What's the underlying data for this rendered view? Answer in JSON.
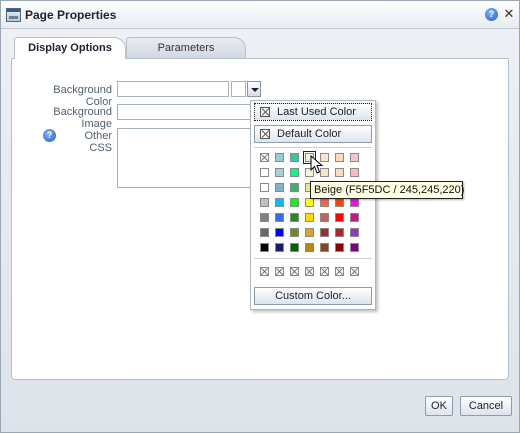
{
  "window": {
    "title": "Page Properties",
    "help_label": "?",
    "close_label": "✕"
  },
  "tabs": [
    {
      "label": "Display Options",
      "active": true
    },
    {
      "label": "Parameters",
      "active": false
    }
  ],
  "form": {
    "background_color": {
      "label": "Background Color",
      "value": ""
    },
    "background_image": {
      "label": "Background Image",
      "value": ""
    },
    "other_css": {
      "label": "Other CSS",
      "value": "",
      "help_label": "?"
    }
  },
  "color_picker": {
    "last_used_label": "Last Used Color",
    "default_label": "Default Color",
    "custom_label": "Custom Color...",
    "hovered_tooltip": "Beige (F5F5DC / 245,245,220)",
    "palette": [
      [
        "",
        "#99CCCC",
        "#33CC99",
        "#F5F5DC",
        "#FFE4C4",
        "#FFDAB9",
        "#FFC0CB"
      ],
      [
        "#FFFFFF",
        "#A8D0D8",
        "#00FF7F",
        "#F5F5DC",
        "#FFE4C4",
        "#FFDAB9",
        "#FFB6C1"
      ],
      [
        "#FFFFFF",
        "#7EB4CC",
        "#3CB371",
        "#F0E68C",
        "#FA8072",
        "#F4A460",
        "#EE82EE"
      ],
      [
        "#C0C0C0",
        "#00BFFF",
        "#00FF00",
        "#FFFF00",
        "#FF6347",
        "#FF4500",
        "#FF00FF"
      ],
      [
        "#808080",
        "#4169E1",
        "#228B22",
        "#FFD700",
        "#CD5C5C",
        "#FF0000",
        "#C71585"
      ],
      [
        "#696969",
        "#0000FF",
        "#6B8E23",
        "#DAA520",
        "#A52A2A",
        "#B22222",
        "#9932CC"
      ],
      [
        "#000000",
        "#191970",
        "#006400",
        "#B8860B",
        "#8B4513",
        "#8B0000",
        "#800080"
      ]
    ],
    "recent_count": 7
  },
  "footer": {
    "ok_label": "OK",
    "cancel_label": "Cancel"
  }
}
